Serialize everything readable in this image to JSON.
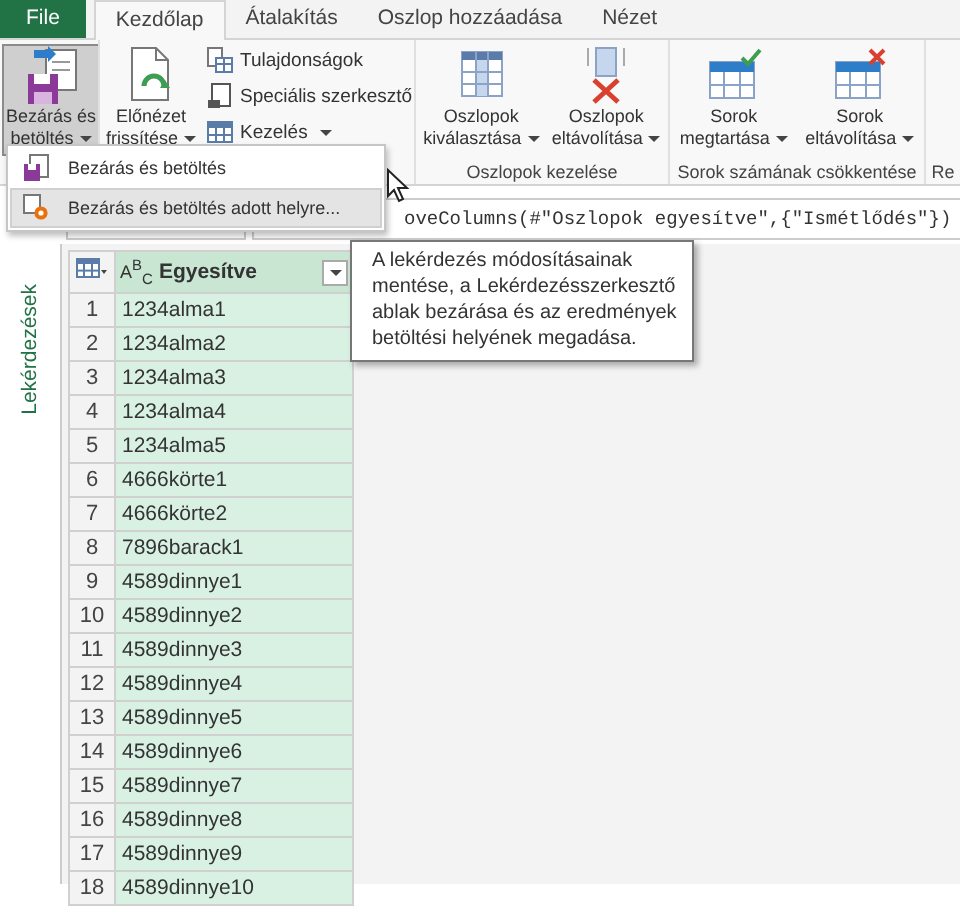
{
  "tabs": [
    {
      "label": "File",
      "kind": "file",
      "selected": false
    },
    {
      "label": "Kezdőlap",
      "kind": "tab",
      "selected": true
    },
    {
      "label": "Átalakítás",
      "kind": "tab",
      "selected": false
    },
    {
      "label": "Oszlop hozzáadása",
      "kind": "tab",
      "selected": false
    },
    {
      "label": "Nézet",
      "kind": "tab",
      "selected": false
    }
  ],
  "ribbon": {
    "groups": [
      {
        "buttons": [
          {
            "kind": "large",
            "lines": [
              "Bezárás és",
              "betöltés"
            ],
            "dropdown": true,
            "pressed": true
          }
        ]
      },
      {
        "buttons": [
          {
            "kind": "large",
            "lines": [
              "Előnézet",
              "frissítése"
            ],
            "dropdown": true,
            "pressed": false
          },
          {
            "kind": "small",
            "lines": [
              "Tulajdonságok"
            ],
            "dropdown": false,
            "pressed": false
          },
          {
            "kind": "small",
            "lines": [
              "Speciális szerkesztő"
            ],
            "dropdown": false,
            "pressed": false
          },
          {
            "kind": "small",
            "lines": [
              "Kezelés"
            ],
            "dropdown": true,
            "pressed": false
          }
        ]
      },
      {
        "label": "Oszlopok kezelése",
        "buttons": [
          {
            "kind": "large",
            "lines": [
              "Oszlopok",
              "kiválasztása"
            ],
            "dropdown": true,
            "pressed": false
          },
          {
            "kind": "large",
            "lines": [
              "Oszlopok",
              "eltávolítása"
            ],
            "dropdown": true,
            "pressed": false
          }
        ]
      },
      {
        "label": "Sorok számának csökkentése",
        "buttons": [
          {
            "kind": "large",
            "lines": [
              "Sorok",
              "megtartása"
            ],
            "dropdown": true,
            "pressed": false
          },
          {
            "kind": "large",
            "lines": [
              "Sorok",
              "eltávolítása"
            ],
            "dropdown": true,
            "pressed": false
          }
        ]
      },
      {
        "label": "Re"
      }
    ]
  },
  "menu": {
    "items": [
      {
        "label": "Bezárás és betöltés",
        "selected": false
      },
      {
        "label": "Bezárás és betöltés adott helyre...",
        "selected": true
      }
    ]
  },
  "formula": {
    "text": "oveColumns(#\"Oszlopok egyesítve\",{\"Ismétlődés\"})"
  },
  "tooltip": {
    "text": "A lekérdezés módosításainak\nmentése, a Lekérdezésszerkesztő\nablak bezárása és az eredmények\nbetöltési helyének megadása."
  },
  "sidebar": {
    "title": "Lekérdezések"
  },
  "table": {
    "columns": [
      {
        "label": "Egyesítve",
        "type_icon": "A$^{B}$$_{C}$",
        "selected": true
      }
    ],
    "rows": [
      {
        "index": "1",
        "value": "1234alma1"
      },
      {
        "index": "2",
        "value": "1234alma2"
      },
      {
        "index": "3",
        "value": "1234alma3"
      },
      {
        "index": "4",
        "value": "1234alma4"
      },
      {
        "index": "5",
        "value": "1234alma5"
      },
      {
        "index": "6",
        "value": "4666körte1"
      },
      {
        "index": "7",
        "value": "4666körte2"
      },
      {
        "index": "8",
        "value": "7896barack1"
      },
      {
        "index": "9",
        "value": "4589dinnye1"
      },
      {
        "index": "10",
        "value": "4589dinnye2"
      },
      {
        "index": "11",
        "value": "4589dinnye3"
      },
      {
        "index": "12",
        "value": "4589dinnye4"
      },
      {
        "index": "13",
        "value": "4589dinnye5"
      },
      {
        "index": "14",
        "value": "4589dinnye6"
      },
      {
        "index": "15",
        "value": "4589dinnye7"
      },
      {
        "index": "16",
        "value": "4589dinnye8"
      },
      {
        "index": "17",
        "value": "4589dinnye9"
      },
      {
        "index": "18",
        "value": "4589dinnye10"
      }
    ]
  }
}
